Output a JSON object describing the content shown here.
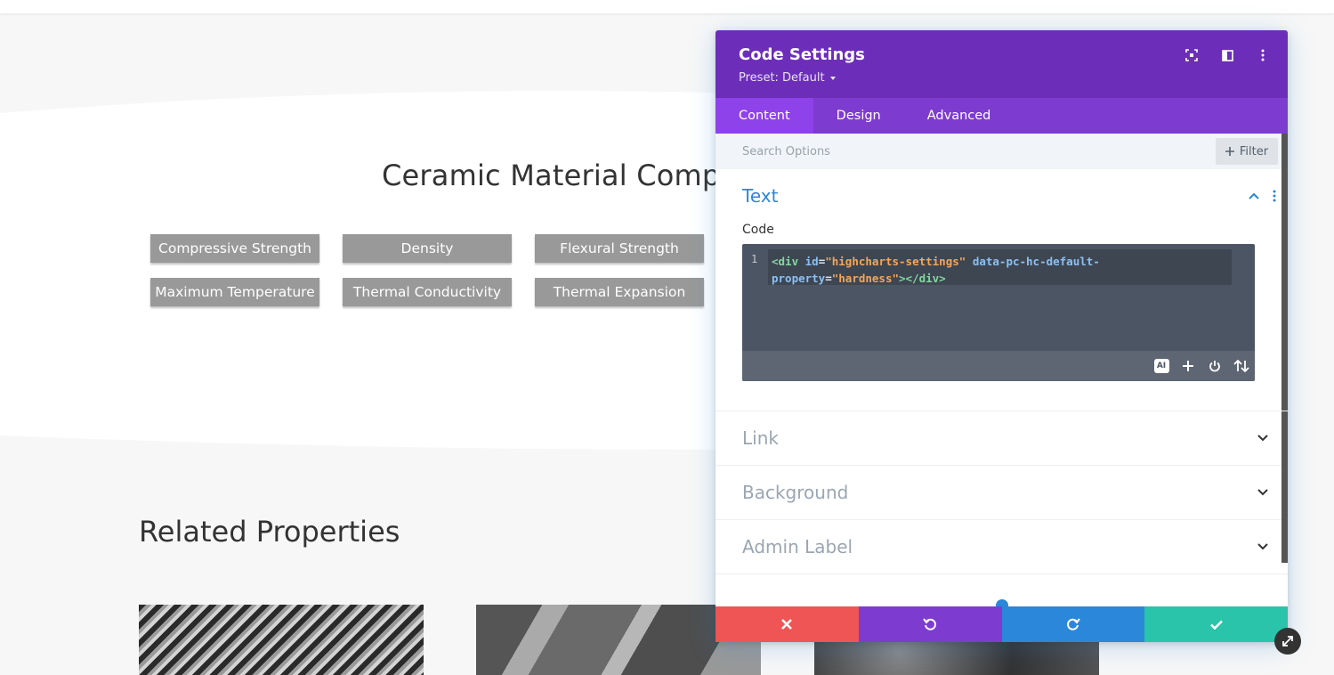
{
  "page": {
    "title": "Ceramic Material Compar",
    "buttons": [
      "Compressive Strength",
      "Density",
      "Flexural Strength",
      "Maximum Temperature",
      "Thermal Conductivity",
      "Thermal Expansion"
    ],
    "related_title": "Related Properties"
  },
  "panel": {
    "title": "Code Settings",
    "preset": "Preset: Default",
    "tabs": [
      "Content",
      "Design",
      "Advanced"
    ],
    "active_tab": "Content",
    "search_placeholder": "Search Options",
    "filter_label": "Filter",
    "sections": {
      "text": {
        "title": "Text",
        "field_label": "Code",
        "line_number": "1",
        "code": {
          "open": "<div",
          "attr1": "id",
          "val1": "\"highcharts-settings\"",
          "attr2a": "data-pc-hc-default-",
          "attr2b": "property",
          "val2": "\"hardness\"",
          "close": "></div>"
        },
        "ai_label": "AI"
      },
      "closed": [
        "Link",
        "Background",
        "Admin Label"
      ]
    },
    "colors": {
      "header": "#6c2eb9",
      "tabs": "#7e3bd0",
      "active_tab": "#8e42ea",
      "cancel": "#ef5555",
      "undo": "#7e3bd0",
      "redo": "#2b87da",
      "save": "#29c4a9"
    }
  }
}
